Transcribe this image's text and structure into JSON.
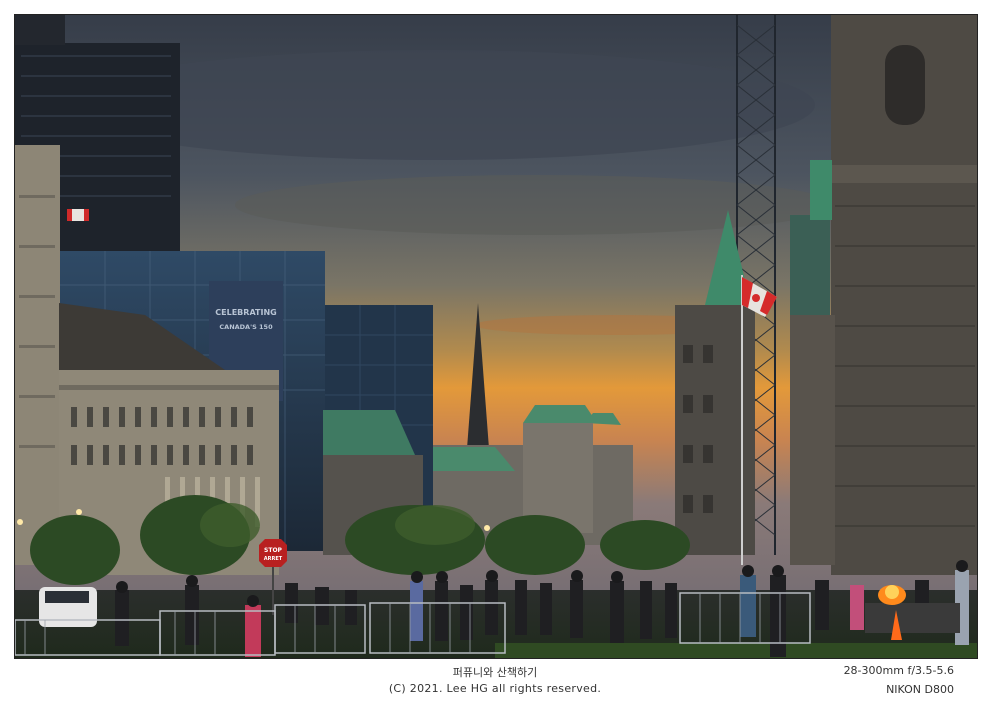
{
  "photo": {
    "description_alt": "Dusk view of Parliament Hill area with crowd, flame and Canadian flag",
    "signs": {
      "stop_sign": "STOP",
      "arret_sign": "ARRET",
      "banner_line1": "CELEBRATING",
      "banner_line2": "CANADA'S 150"
    }
  },
  "captions": {
    "title": "퍼퓨니와 산책하기",
    "copyright": "(C) 2021. Lee HG all rights reserved.",
    "lens": "28-300mm f/3.5-5.6",
    "camera": "NIKON D800"
  },
  "colors": {
    "sky_top": "#3b4350",
    "sky_glow": "#e39a3c",
    "stone": "#5b5650",
    "copper_roof": "#3f8a6a",
    "flag_red": "#d52b2b"
  }
}
